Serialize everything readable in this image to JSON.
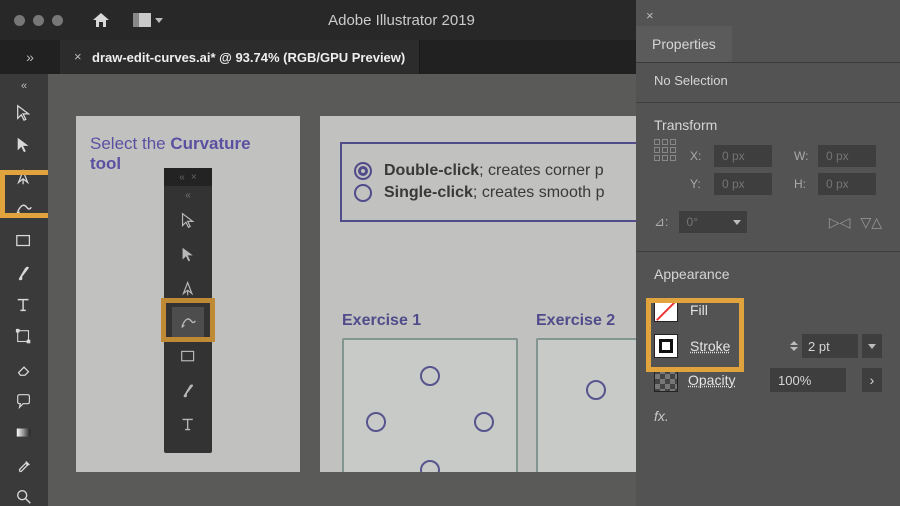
{
  "app": {
    "title": "Adobe Illustrator 2019"
  },
  "tabs": {
    "doc": {
      "label": "draw-edit-curves.ai* @ 93.74% (RGB/GPU Preview)"
    }
  },
  "left_toolbar": {
    "collapse_glyph": "«",
    "tools": [
      {
        "name": "selection-tool",
        "type": "arrow"
      },
      {
        "name": "direct-selection-tool",
        "type": "arrow-solid"
      },
      {
        "name": "pen-tool",
        "type": "pen"
      },
      {
        "name": "curvature-tool",
        "type": "curvature"
      },
      {
        "name": "rectangle-tool",
        "type": "rect"
      },
      {
        "name": "paintbrush-tool",
        "type": "brush"
      },
      {
        "name": "type-tool",
        "type": "type"
      },
      {
        "name": "free-transform-tool",
        "type": "transform"
      },
      {
        "name": "eraser-tool",
        "type": "eraser"
      },
      {
        "name": "symbol-sprayer-tool",
        "type": "speech"
      },
      {
        "name": "gradient-tool",
        "type": "gradient"
      },
      {
        "name": "eyedropper-tool",
        "type": "eyedropper"
      },
      {
        "name": "zoom-tool",
        "type": "zoom"
      }
    ]
  },
  "canvas": {
    "artboard1": {
      "title_prefix": "Select the ",
      "title_bold": "Curvature tool"
    },
    "callouts": [
      {
        "bold": "Double-click",
        "rest": "; creates corner p"
      },
      {
        "bold": "Single-click",
        "rest": "; creates smooth p"
      }
    ],
    "exercise1_label": "Exercise 1",
    "exercise2_label": "Exercise 2"
  },
  "mini_toolbar": {
    "collapse_glyph": "«",
    "tools": [
      {
        "name": "mini-selection",
        "type": "arrow"
      },
      {
        "name": "mini-direct",
        "type": "arrow-solid"
      },
      {
        "name": "mini-pen",
        "type": "pen"
      },
      {
        "name": "mini-curvature",
        "type": "curvature",
        "active": true
      },
      {
        "name": "mini-rect",
        "type": "rect"
      },
      {
        "name": "mini-brush",
        "type": "brush"
      },
      {
        "name": "mini-type",
        "type": "type"
      }
    ]
  },
  "properties": {
    "tab_label": "Properties",
    "selection_status": "No Selection",
    "transform": {
      "title": "Transform",
      "x_label": "X:",
      "x_value": "0 px",
      "y_label": "Y:",
      "y_value": "0 px",
      "w_label": "W:",
      "w_value": "0 px",
      "h_label": "H:",
      "h_value": "0 px",
      "rot_label": "⊿:",
      "rot_value": "0°",
      "flip_h_glyph": "▷◁",
      "flip_v_glyph": "▽△"
    },
    "appearance": {
      "title": "Appearance",
      "fill_label": "Fill",
      "stroke_label": "Stroke",
      "stroke_weight": "2 pt",
      "opacity_label": "Opacity",
      "opacity_value": "100%",
      "fx_label": "fx."
    }
  }
}
